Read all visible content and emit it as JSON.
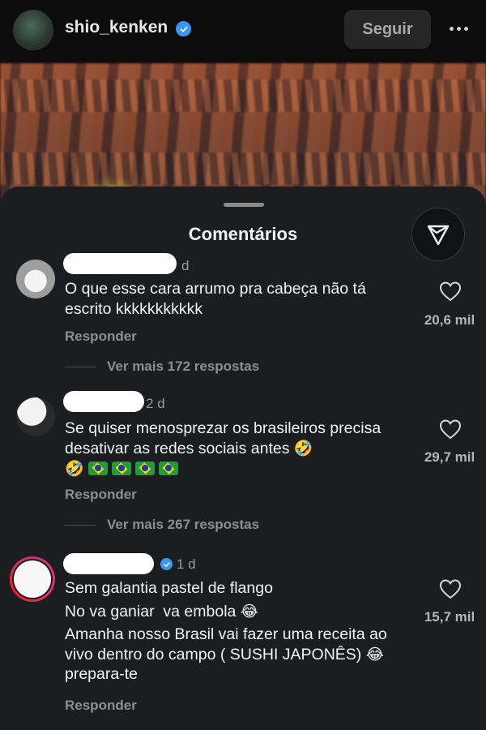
{
  "header": {
    "username": "shio_kenken",
    "follow_label": "Seguir"
  },
  "sheet": {
    "title": "Comentários"
  },
  "comments": [
    {
      "time": "d",
      "text": "O que esse cara arrumo pra cabeça não tá escrito kkkkkkkkkkk",
      "reply_label": "Responder",
      "more_replies": "Ver mais 172 respostas",
      "likes": "20,6 mil"
    },
    {
      "time": "2 d",
      "text": "Se quiser menosprezar os brasileiros precisa desativar as redes sociais antes",
      "reply_label": "Responder",
      "more_replies": "Ver mais 267 respostas",
      "likes": "29,7 mil"
    },
    {
      "time": "1 d",
      "line1": "Sem galantia pastel de flango",
      "line2": "No va ganiar  va embola",
      "line3": "Amanha nosso Brasil vai fazer uma receita ao vivo dentro do campo ( SUSHI JAPONÊS)",
      "line3_end": "prepara-te",
      "reply_label": "Responder",
      "likes": "15,7 mil"
    }
  ],
  "colors": {
    "sheet_bg": "#1c1d21",
    "verified": "#3897f0"
  }
}
